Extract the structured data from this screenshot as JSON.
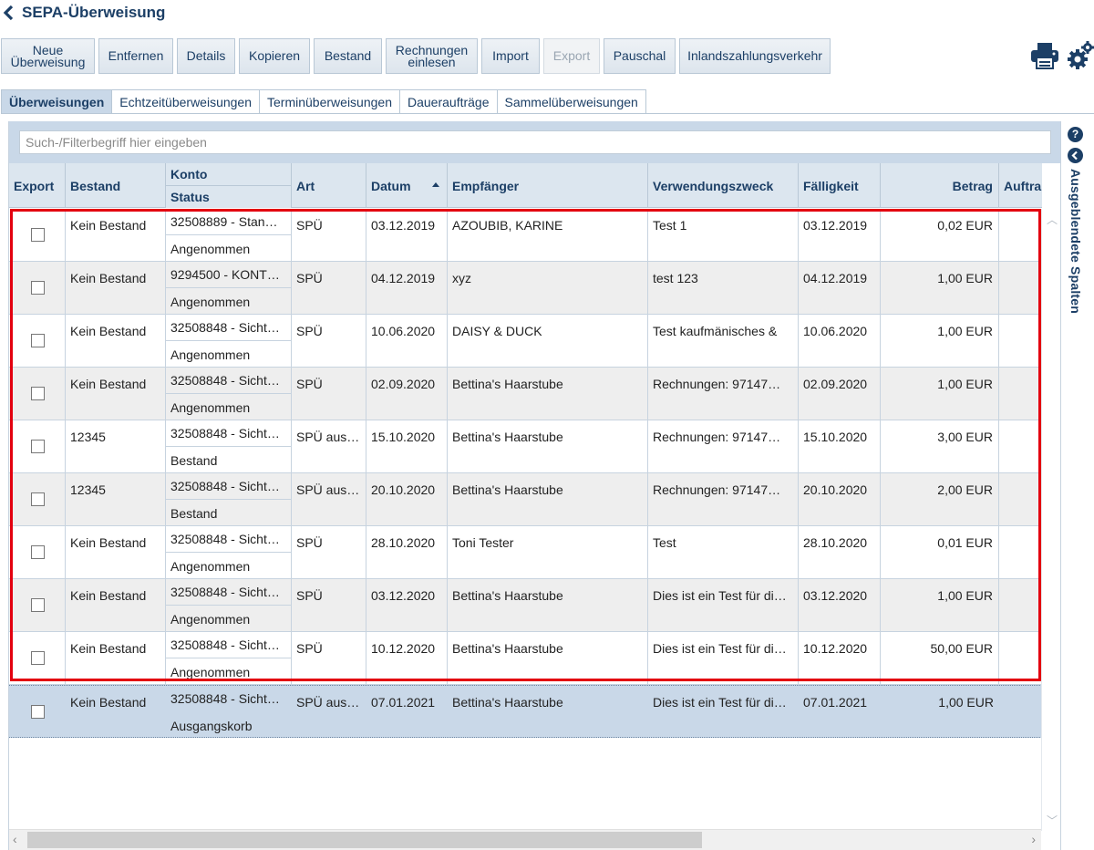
{
  "page": {
    "title": "SEPA-Überweisung"
  },
  "toolbar": {
    "buttons": [
      {
        "label": "Neue Überweisung",
        "line1": "Neue",
        "line2": "Überweisung"
      },
      {
        "label": "Entfernen"
      },
      {
        "label": "Details"
      },
      {
        "label": "Kopieren"
      },
      {
        "label": "Bestand"
      },
      {
        "label": "Rechnungen einlesen",
        "line1": "Rechnungen",
        "line2": "einlesen"
      },
      {
        "label": "Import"
      },
      {
        "label": "Export",
        "disabled": true
      },
      {
        "label": "Pauschal"
      },
      {
        "label": "Inlandszahlungsverkehr"
      }
    ],
    "icons": [
      "printer-icon",
      "gears-icon"
    ]
  },
  "tabs": [
    {
      "label": "Überweisungen",
      "active": true
    },
    {
      "label": "Echtzeitüberweisungen"
    },
    {
      "label": "Terminüberweisungen"
    },
    {
      "label": "Daueraufträge"
    },
    {
      "label": "Sammelüberweisungen"
    }
  ],
  "filter": {
    "placeholder": "Such-/Filterbegriff hier eingeben"
  },
  "columns": {
    "export": "Export",
    "bestand": "Bestand",
    "konto": "Konto",
    "status": "Status",
    "art": "Art",
    "datum": "Datum",
    "empfaenger": "Empfänger",
    "verwendungszweck": "Verwendungszweck",
    "faelligkeit": "Fälligkeit",
    "betrag": "Betrag",
    "auftrag": "Auftra"
  },
  "rows": [
    {
      "bestand": "Kein Bestand",
      "konto": "32508889 - Stan…",
      "status": "Angenommen",
      "art": "SPÜ",
      "datum": "03.12.2019",
      "empfaenger": "AZOUBIB, KARINE",
      "zweck": "Test 1",
      "faellig": "03.12.2019",
      "betrag": "0,02 EUR"
    },
    {
      "bestand": "Kein Bestand",
      "konto": "9294500 - KONT…",
      "status": "Angenommen",
      "art": "SPÜ",
      "datum": "04.12.2019",
      "empfaenger": "xyz",
      "zweck": "test 123",
      "faellig": "04.12.2019",
      "betrag": "1,00 EUR"
    },
    {
      "bestand": "Kein Bestand",
      "konto": "32508848 - Sicht…",
      "status": "Angenommen",
      "art": "SPÜ",
      "datum": "10.06.2020",
      "empfaenger": "DAISY & DUCK",
      "zweck": "Test kaufmänisches &",
      "faellig": "10.06.2020",
      "betrag": "1,00 EUR"
    },
    {
      "bestand": "Kein Bestand",
      "konto": "32508848 - Sicht…",
      "status": "Angenommen",
      "art": "SPÜ",
      "datum": "02.09.2020",
      "empfaenger": "Bettina's Haarstube",
      "zweck": "Rechnungen:  97147…",
      "faellig": "02.09.2020",
      "betrag": "1,00 EUR"
    },
    {
      "bestand": "12345",
      "konto": "32508848 - Sicht…",
      "status": "Bestand",
      "art": "SPÜ aus…",
      "datum": "15.10.2020",
      "empfaenger": "Bettina's Haarstube",
      "zweck": "Rechnungen:  97147…",
      "faellig": "15.10.2020",
      "betrag": "3,00 EUR"
    },
    {
      "bestand": "12345",
      "konto": "32508848 - Sicht…",
      "status": "Bestand",
      "art": "SPÜ aus…",
      "datum": "20.10.2020",
      "empfaenger": "Bettina's Haarstube",
      "zweck": "Rechnungen:  97147…",
      "faellig": "20.10.2020",
      "betrag": "2,00 EUR"
    },
    {
      "bestand": "Kein Bestand",
      "konto": "32508848 - Sicht…",
      "status": "Angenommen",
      "art": "SPÜ",
      "datum": "28.10.2020",
      "empfaenger": "Toni Tester",
      "zweck": "Test",
      "faellig": "28.10.2020",
      "betrag": "0,01 EUR"
    },
    {
      "bestand": "Kein Bestand",
      "konto": "32508848 - Sicht…",
      "status": "Angenommen",
      "art": "SPÜ",
      "datum": "03.12.2020",
      "empfaenger": "Bettina's Haarstube",
      "zweck": "Dies ist ein Test für di…",
      "faellig": "03.12.2020",
      "betrag": "1,00 EUR"
    },
    {
      "bestand": "Kein Bestand",
      "konto": "32508848 - Sicht…",
      "status": "Angenommen",
      "art": "SPÜ",
      "datum": "10.12.2020",
      "empfaenger": "Bettina's Haarstube",
      "zweck": "Dies ist ein Test für di…",
      "faellig": "10.12.2020",
      "betrag": "50,00 EUR"
    },
    {
      "bestand": "Kein Bestand",
      "konto": "32508848 - Sicht…",
      "status": "Ausgangskorb",
      "art": "SPÜ aus…",
      "datum": "07.01.2021",
      "empfaenger": "Bettina's Haarstube",
      "zweck": "Dies ist ein Test für di…",
      "faellig": "07.01.2021",
      "betrag": "1,00 EUR",
      "selected": true
    }
  ],
  "side_panel": {
    "label": "Ausgeblendete Spalten",
    "help": "?"
  },
  "colors": {
    "accent": "#1c3f66",
    "header_bg": "#dce6ef",
    "selected_bg": "#c9d8e8",
    "highlight_border": "#e3000f"
  }
}
